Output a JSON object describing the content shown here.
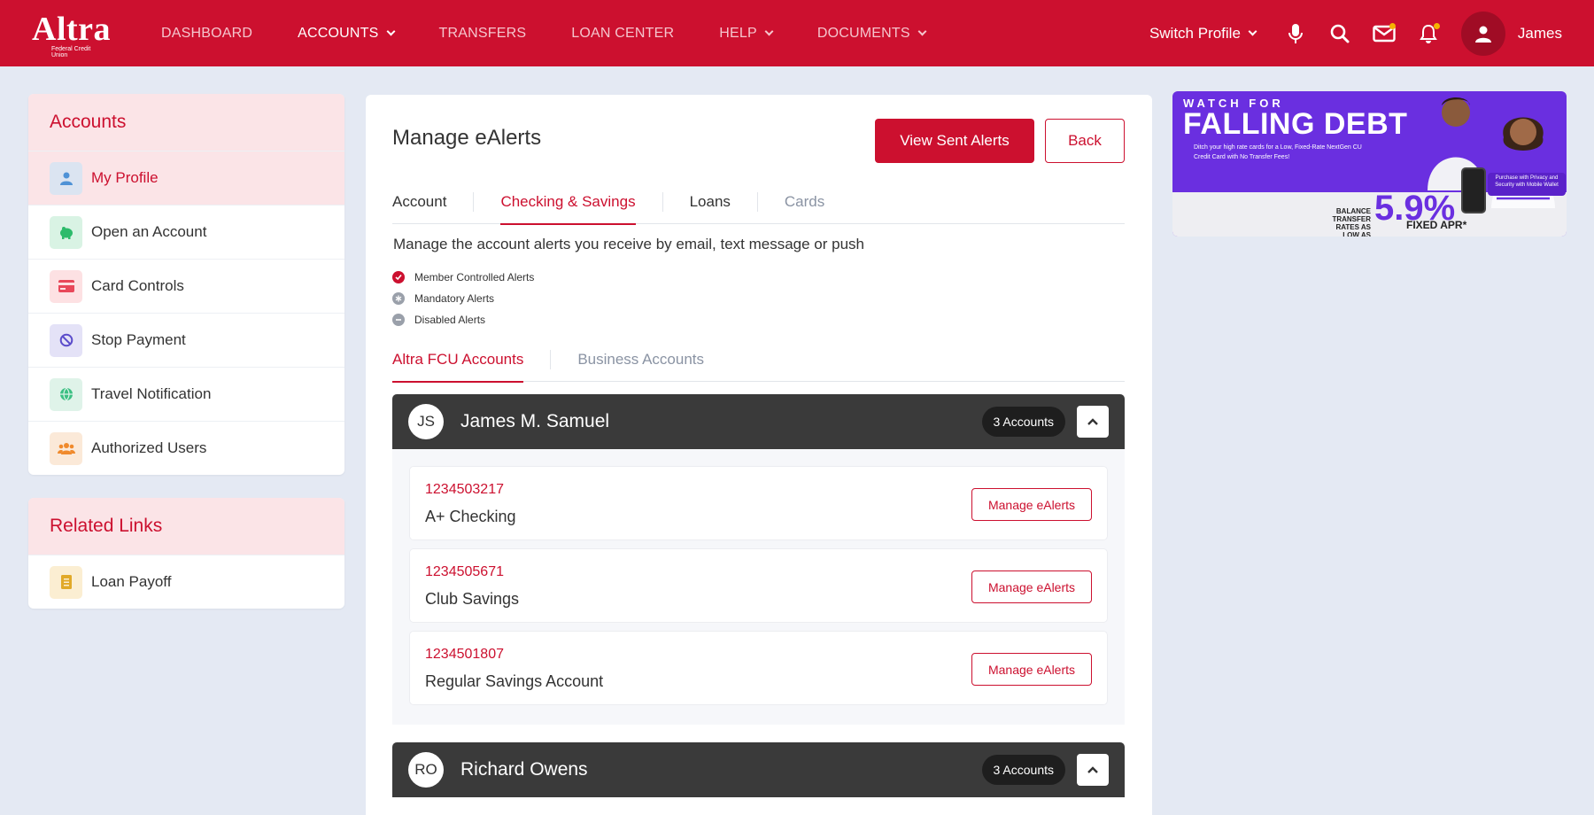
{
  "header": {
    "logo": "Altra",
    "logo_sub": "Federal Credit Union",
    "nav": [
      {
        "label": "DASHBOARD",
        "dropdown": false,
        "active": false
      },
      {
        "label": "ACCOUNTS",
        "dropdown": true,
        "active": true
      },
      {
        "label": "TRANSFERS",
        "dropdown": false,
        "active": false
      },
      {
        "label": "LOAN CENTER",
        "dropdown": false,
        "active": false
      },
      {
        "label": "HELP",
        "dropdown": true,
        "active": false
      },
      {
        "label": "DOCUMENTS",
        "dropdown": true,
        "active": false
      }
    ],
    "switch_profile": "Switch Profile",
    "user_name": "James"
  },
  "sidebar": {
    "accounts_title": "Accounts",
    "items": [
      {
        "label": "My Profile",
        "icon": "user-icon",
        "active": true
      },
      {
        "label": "Open an Account",
        "icon": "piggy-bank-icon"
      },
      {
        "label": "Card Controls",
        "icon": "credit-card-icon"
      },
      {
        "label": "Stop Payment",
        "icon": "ban-icon"
      },
      {
        "label": "Travel Notification",
        "icon": "globe-icon"
      },
      {
        "label": "Authorized Users",
        "icon": "users-icon"
      }
    ],
    "related_title": "Related Links",
    "related_items": [
      {
        "label": "Loan Payoff",
        "icon": "document-icon"
      }
    ]
  },
  "main": {
    "title": "Manage eAlerts",
    "view_sent_label": "View Sent Alerts",
    "back_label": "Back",
    "tabs": [
      "Account",
      "Checking & Savings",
      "Loans",
      "Cards"
    ],
    "active_tab": "Checking & Savings",
    "description": "Manage the account alerts you receive by email, text message or push",
    "legend": [
      "Member Controlled Alerts",
      "Mandatory Alerts",
      "Disabled Alerts"
    ],
    "subtabs": [
      "Altra FCU Accounts",
      "Business Accounts"
    ],
    "groups": [
      {
        "initials": "JS",
        "name": "James M. Samuel",
        "count": "3 Accounts",
        "accounts": [
          {
            "number": "1234503217",
            "name": "A+ Checking",
            "action": "Manage eAlerts"
          },
          {
            "number": "1234505671",
            "name": "Club Savings",
            "action": "Manage eAlerts"
          },
          {
            "number": "1234501807",
            "name": "Regular Savings Account",
            "action": "Manage eAlerts"
          }
        ]
      },
      {
        "initials": "RO",
        "name": "Richard Owens",
        "count": "3 Accounts"
      }
    ]
  },
  "ad": {
    "watch": "WATCH FOR",
    "headline": "FALLING DEBT",
    "small_text": "Ditch your high rate cards for a Low, Fixed-Rate NextGen CU Credit Card with No Transfer Fees!",
    "rate_label": "BALANCE TRANSFER RATES AS LOW AS",
    "rate": "5.9%",
    "fixed": "FIXED APR*",
    "badge": "Purchase with Privacy and Security with Mobile Wallet"
  },
  "colors": {
    "brand_red": "#cc102f",
    "page_bg": "#e4e9f3",
    "group_header": "#3a3a3a",
    "ad_purple": "#6a2fe0"
  }
}
